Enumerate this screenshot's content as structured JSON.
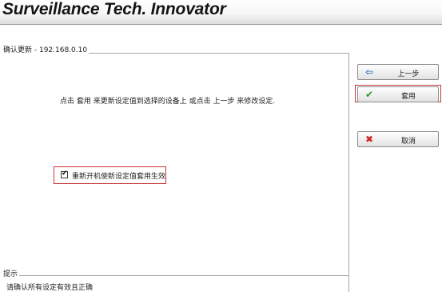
{
  "header": {
    "title": "Surveillance Tech. Innovator"
  },
  "main": {
    "legend": "确认更新 - 192.168.0.10",
    "instruction": "点击 套用 来更新设定值到选择的设备上 或点击 上一步 来修改设定.",
    "reboot_checkbox": {
      "label": "重新开机使新设定值套用生效",
      "checked": true
    }
  },
  "buttons": {
    "prev": "上一步",
    "apply": "套用",
    "cancel": "取消"
  },
  "hint": {
    "legend": "提示",
    "text": "请确认所有设定有效且正确"
  },
  "icons": {
    "prev": "arrow-left-icon",
    "apply": "check-icon",
    "cancel": "x-icon"
  },
  "colors": {
    "highlight": "#c8363a",
    "apply_icon": "#2e9b2b",
    "cancel_icon": "#d12222",
    "prev_icon": "#2f6fbd"
  }
}
